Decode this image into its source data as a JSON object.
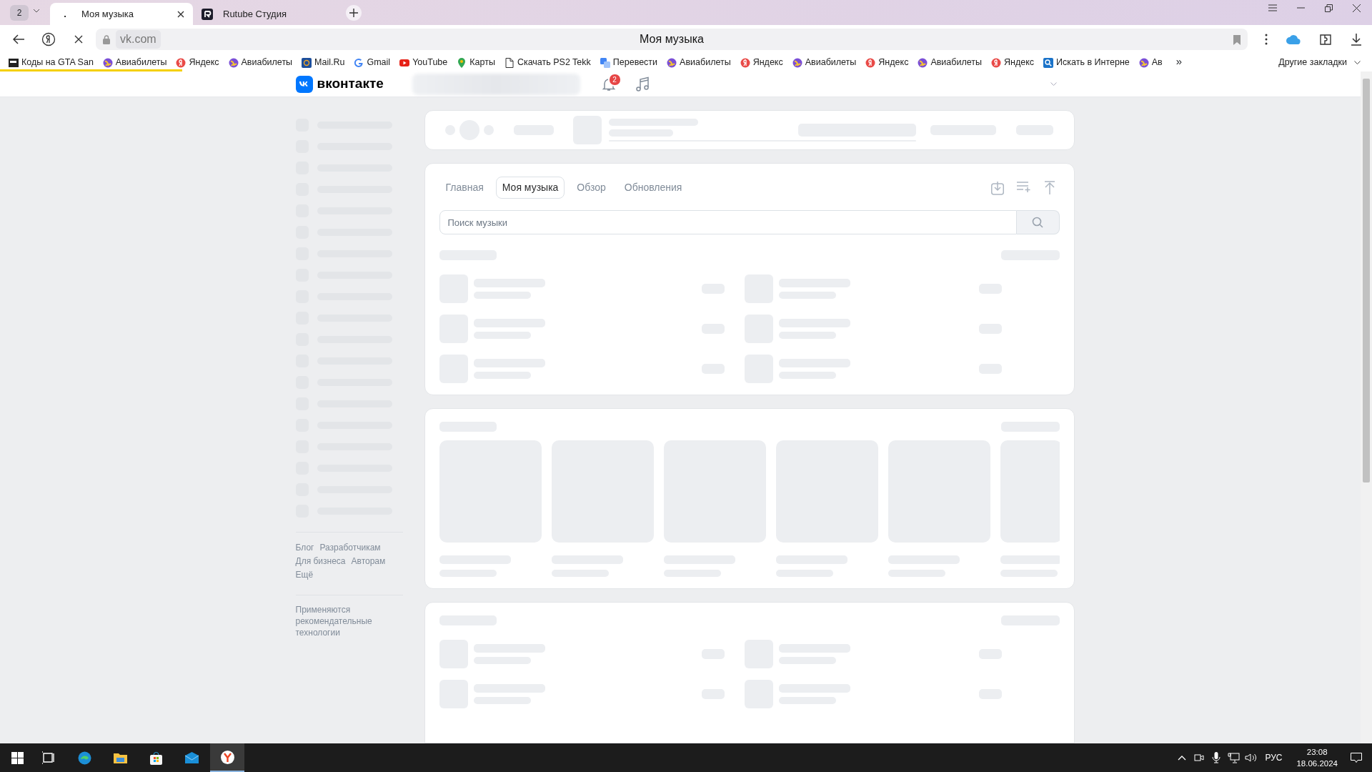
{
  "browser": {
    "tab_counter": "2",
    "tabs": [
      {
        "favicon": ".",
        "title": "Моя музыка",
        "selected": true
      },
      {
        "title": "Rutube Студия",
        "selected": false
      }
    ],
    "address": "vk.com",
    "page_title": "Моя музыка",
    "bookmarks": [
      {
        "kind": "gun",
        "label": "Коды на GTA San"
      },
      {
        "kind": "globe",
        "label": "Авиабилеты"
      },
      {
        "kind": "yandex",
        "label": "Яндекс"
      },
      {
        "kind": "globe",
        "label": "Авиабилеты"
      },
      {
        "kind": "mail",
        "label": "Mail.Ru"
      },
      {
        "kind": "google",
        "label": "Gmail"
      },
      {
        "kind": "youtube",
        "label": "YouTube"
      },
      {
        "kind": "maps",
        "label": "Карты"
      },
      {
        "kind": "doc",
        "label": "Скачать PS2 Tekk"
      },
      {
        "kind": "translate",
        "label": "Перевести"
      },
      {
        "kind": "globe",
        "label": "Авиабилеты"
      },
      {
        "kind": "yandex",
        "label": "Яндекс"
      },
      {
        "kind": "globe",
        "label": "Авиабилеты"
      },
      {
        "kind": "yandex",
        "label": "Яндекс"
      },
      {
        "kind": "globe",
        "label": "Авиабилеты"
      },
      {
        "kind": "yandex",
        "label": "Яндекс"
      },
      {
        "kind": "search",
        "label": "Искать в Интерне"
      },
      {
        "kind": "globe",
        "label": "Ав"
      }
    ],
    "more_bookmarks": "»",
    "other_bookmarks": "Другие закладки",
    "loading": {
      "level": 0.133
    }
  },
  "vk": {
    "logo_text": "вконтакте",
    "notifications_badge": "2",
    "music_tabs": [
      {
        "label": "Главная",
        "selected": false
      },
      {
        "label": "Моя музыка",
        "selected": true
      },
      {
        "label": "Обзор",
        "selected": false
      },
      {
        "label": "Обновления",
        "selected": false
      }
    ],
    "search": {
      "placeholder": "Поиск музыки"
    },
    "footer_links": [
      "Блог",
      "Разработчикам",
      "Для бизнеса",
      "Авторам",
      "Ещё"
    ],
    "recommendation_note": "Применяются рекомендательные технологии"
  },
  "taskbar": {
    "language": "РУС",
    "time": "23:08",
    "date": "18.06.2024"
  }
}
